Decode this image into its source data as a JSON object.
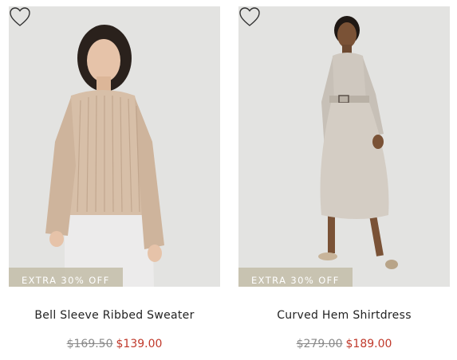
{
  "products": [
    {
      "name": "Bell Sleeve Ribbed Sweater",
      "badge": "EXTRA 30% OFF",
      "original_price": "$169.50",
      "sale_price": "$139.00",
      "favorite_icon": "heart-outline-icon"
    },
    {
      "name": "Curved Hem Shirtdress",
      "badge": "EXTRA 30% OFF",
      "original_price": "$279.00",
      "sale_price": "$189.00",
      "favorite_icon": "heart-outline-icon"
    }
  ],
  "colors": {
    "background": "#ffffff",
    "photo_bg": "#e3e3e1",
    "badge_bg": "#c4beaa",
    "sale_price": "#c0392b",
    "original_price": "#8a8a8a"
  }
}
